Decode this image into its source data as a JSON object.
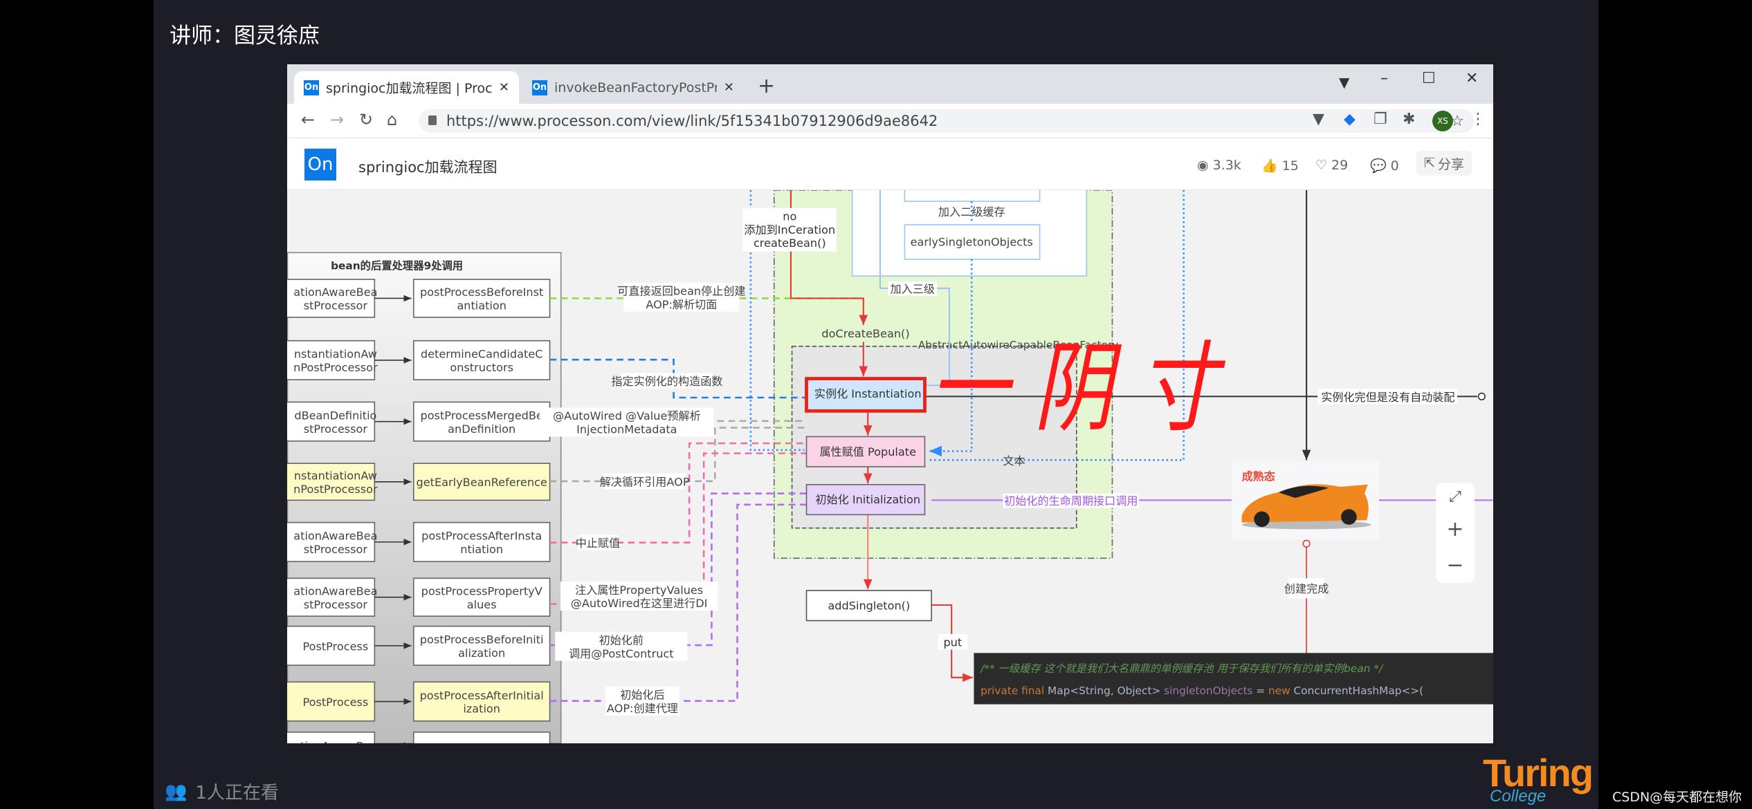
{
  "overlay": {
    "lecturer": "讲师：图灵徐庶",
    "viewers": "1人正在看",
    "watermark": "CSDN@每天都在想你",
    "brand_logo": "Turing College"
  },
  "browser": {
    "tabs": [
      {
        "title": "springioc加载流程图 | ProcessOn",
        "favicon": "On",
        "active": true
      },
      {
        "title": "invokeBeanFactoryPostProcessors",
        "favicon": "On",
        "active": false
      }
    ],
    "url": "https://www.processon.com/view/link/5f15341b07912906d9ae8642",
    "profile_initials": "XS"
  },
  "page": {
    "logo": "On",
    "title": "springioc加载流程图",
    "views": "3.3k",
    "likes": "15",
    "favorites": "29",
    "comments": "0",
    "share": "分享"
  },
  "diagram": {
    "panel_title": "bean的后置处理器9处调用",
    "left_boxes": [
      {
        "lines": [
          "ationAwareBea",
          "stProcessor"
        ],
        "highlight": false
      },
      {
        "lines": [
          "nstantiationAw",
          "nPostProcessor"
        ],
        "highlight": false
      },
      {
        "lines": [
          "dBeanDefinitio",
          "stProcessor"
        ],
        "highlight": false
      },
      {
        "lines": [
          "nstantiationAw",
          "nPostProcessor"
        ],
        "highlight": true
      },
      {
        "lines": [
          "ationAwareBea",
          "stProcessor"
        ],
        "highlight": false
      },
      {
        "lines": [
          "ationAwareBea",
          "stProcessor"
        ],
        "highlight": false
      },
      {
        "lines": [
          "PostProcess"
        ],
        "highlight": false
      },
      {
        "lines": [
          "PostProcess"
        ],
        "highlight": true
      },
      {
        "lines": [
          "ationAwareBea"
        ],
        "highlight": false
      }
    ],
    "right_boxes": [
      {
        "lines": [
          "postProcessBeforeInst",
          "antiation"
        ],
        "highlight": false
      },
      {
        "lines": [
          "determineCandidateC",
          "onstructors"
        ],
        "highlight": false
      },
      {
        "lines": [
          "postProcessMergedBe",
          "anDefinition"
        ],
        "highlight": false
      },
      {
        "lines": [
          "getEarlyBeanReference"
        ],
        "highlight": true
      },
      {
        "lines": [
          "postProcessAfterInsta",
          "ntiation"
        ],
        "highlight": false
      },
      {
        "lines": [
          "postProcessPropertyV",
          "alues"
        ],
        "highlight": false
      },
      {
        "lines": [
          "postProcessBeforeIniti",
          "alization"
        ],
        "highlight": false
      },
      {
        "lines": [
          "postProcessAfterInitial",
          "ization"
        ],
        "highlight": true
      },
      {
        "lines": [
          ""
        ],
        "highlight": false
      }
    ],
    "edge_labels": [
      [
        "可直接返回bean停止创建",
        "AOP:解析切面"
      ],
      [
        "指定实例化的构造函数"
      ],
      [
        "@AutoWired @Value预解析",
        "InjectionMetadata"
      ],
      [
        "解决循环引用AOP"
      ],
      [
        "中止赋值"
      ],
      [
        "注入属性PropertyValues",
        "@AutoWired在这里进行DI"
      ],
      [
        "初始化前",
        "调用@PostContruct"
      ],
      [
        "初始化后",
        "AOP:创建代理"
      ]
    ],
    "no_label": [
      "no",
      "添加到InCeration",
      "createBean()"
    ],
    "second_cache_label": "加入二级缓存",
    "early_singleton": "earlySingletonObjects",
    "third_cache_label": "加入三级",
    "do_create_bean": "doCreateBean()",
    "factory_label": "AbstractAutowireCapableBeanFactory",
    "instantiation": "实例化 Instantiation",
    "populate": "属性赋值 Populate",
    "initialization": "初始化 Initialization",
    "text_label": "文本",
    "lifecycle_label": "初始化的生命周期接口调用",
    "no_autowire_label": "实例化完但是没有自动装配",
    "mature_label": "成熟态",
    "created_label": "创建完成",
    "add_singleton": "addSingleton()",
    "put_label": "put",
    "code_comment": "/** 一级缓存 这个就是我们大名鼎鼎的单例缓存池 用于保存我们所有的单实例bean */",
    "code_kw": "private final ",
    "code_type": "Map<String, Object> ",
    "code_field": "singletonObjects",
    "code_eq": " = ",
    "code_new": "new ",
    "code_rest": "ConcurrentHashMap<>(",
    "handwriting": "一 阴 寸"
  },
  "colors": {
    "instantiation_fill": "#cfe6fb",
    "populate_fill": "#fbd3e7",
    "initialization_fill": "#e6d4fa",
    "highlight_fill": "#fffbc5",
    "green_region": "#e4f7d0",
    "annotation_red": "#ff1a1a",
    "accent_blue": "#0b7ae6"
  }
}
